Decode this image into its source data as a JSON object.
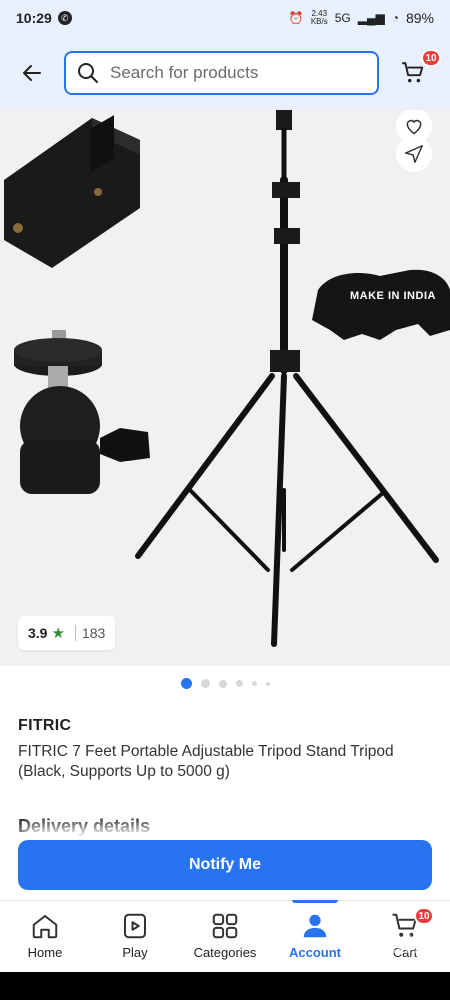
{
  "status_bar": {
    "time": "10:29",
    "net_speed": "2.43",
    "net_unit": "KB/s",
    "net_type": "5G",
    "battery": "89%"
  },
  "header": {
    "search_placeholder": "Search for products",
    "cart_badge": "10"
  },
  "product": {
    "rating": "3.9",
    "rating_count": "183",
    "watermark": "MAKE IN INDIA",
    "brand": "FITRIC",
    "title": "FITRIC 7 Feet Portable Adjustable Tripod Stand Tripod (Black, Supports Up to 5000 g)",
    "image_count": 6,
    "active_image_index": 0
  },
  "delivery_heading": "Delivery details",
  "cta": {
    "notify_label": "Notify Me"
  },
  "bottom_nav": {
    "items": [
      {
        "label": "Home",
        "icon": "home-icon"
      },
      {
        "label": "Play",
        "icon": "play-icon"
      },
      {
        "label": "Categories",
        "icon": "categories-icon"
      },
      {
        "label": "Account",
        "icon": "account-icon"
      },
      {
        "label": "Cart",
        "icon": "cart-icon"
      }
    ],
    "cart_badge": "10",
    "active": "Account"
  },
  "colors": {
    "brand_blue": "#2874f0",
    "badge_red": "#f23c3c",
    "rating_green": "#388e3c"
  }
}
